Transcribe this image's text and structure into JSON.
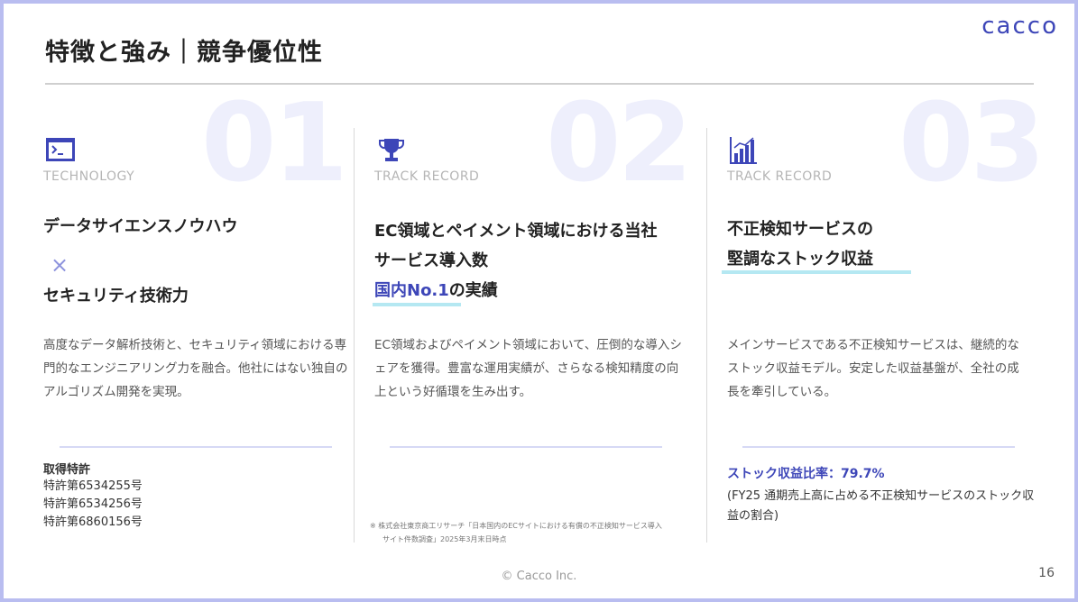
{
  "header": {
    "title": "特徴と強み｜競争優位性",
    "logo": "cacco"
  },
  "columns": [
    {
      "number": "01",
      "icon": "terminal-window-icon",
      "category": "TECHNOLOGY",
      "heading_line1": "データサイエンスノウハウ",
      "times": "×",
      "heading_line2": "セキュリティ技術力",
      "description": "高度なデータ解析技術と、セキュリティ領域における専門的なエンジニアリング力を融合。他社にはない独自のアルゴリズム開発を実現。",
      "patent_title": "取得特許",
      "patents": [
        "特許第6534255号",
        "特許第6534256号",
        "特許第6860156号"
      ]
    },
    {
      "number": "02",
      "icon": "trophy-icon",
      "category": "TRACK RECORD",
      "heading_line1": "EC領域とペイメント領域における当社",
      "heading_line2": "サービス導入数",
      "heading_line3_highlight": "国内No.1",
      "heading_line3_rest": "の実績",
      "description": "EC領域およびペイメント領域において、圧倒的な導入シェアを獲得。豊富な運用実績が、さらなる検知精度の向上という好循環を生み出す。",
      "note_line1": "※ 株式会社東京商工リサーチ「日本国内のECサイトにおける有償の不正検知サービス導入",
      "note_line2": "サイト件数調査」2025年3月末日時点"
    },
    {
      "number": "03",
      "icon": "bar-chart-icon",
      "category": "TRACK RECORD",
      "heading_line1": "不正検知サービスの",
      "heading_line2": "堅調なストック収益",
      "description": "メインサービスである不正検知サービスは、継続的なストック収益モデル。安定した収益基盤が、全社の成長を牽引している。",
      "stock_ratio": "ストック収益比率：79.7%",
      "stock_note": "(FY25 通期売上高に占める不正検知サービスのストック収益の割合)"
    }
  ],
  "footer": {
    "copyright": "© Cacco Inc.",
    "page_number": "16"
  },
  "colors": {
    "accent": "#3d46b8",
    "underline": "#b5e8f2",
    "frame": "#b9bdf0"
  }
}
